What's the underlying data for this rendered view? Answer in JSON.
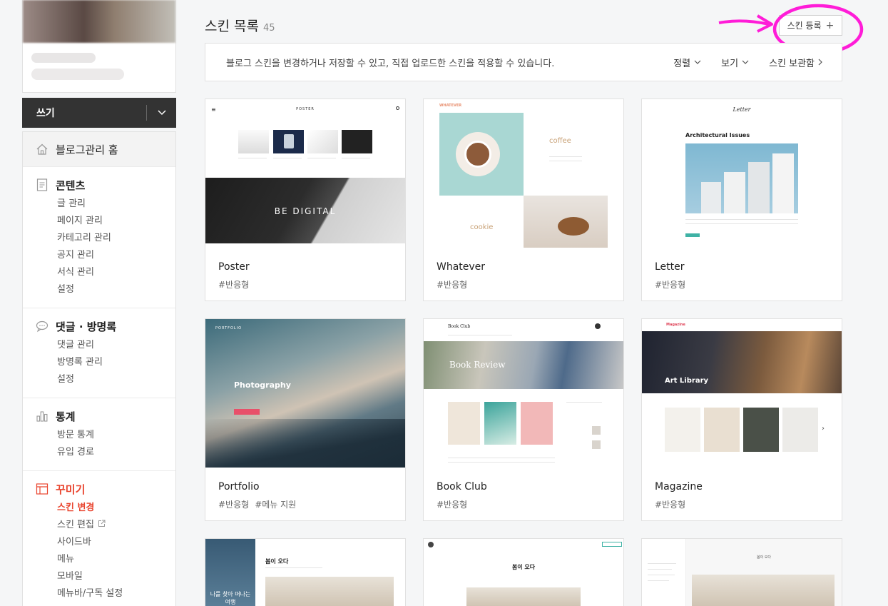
{
  "sidebar": {
    "write_label": "쓰기",
    "home_label": "블로그관리 홈",
    "sections": [
      {
        "title": "콘텐츠",
        "items": [
          "글 관리",
          "페이지 관리",
          "카테고리 관리",
          "공지 관리",
          "서식 관리",
          "설정"
        ]
      },
      {
        "title": "댓글 · 방명록",
        "items": [
          "댓글 관리",
          "방명록 관리",
          "설정"
        ]
      },
      {
        "title": "통계",
        "items": [
          "방문 통계",
          "유입 경로"
        ]
      },
      {
        "title": "꾸미기",
        "items": [
          "스킨 변경",
          "스킨 편집",
          "사이드바",
          "메뉴",
          "모바일",
          "메뉴바/구독 설정"
        ]
      }
    ]
  },
  "header": {
    "title": "스킨 목록",
    "count": "45",
    "register_label": "스킨 등록"
  },
  "info_bar": {
    "text": "블로그 스킨을 변경하거나 저장할 수 있고, 직접 업로드한 스킨을 적용할 수 있습니다.",
    "sort_label": "정렬",
    "view_label": "보기",
    "storage_label": "스킨 보관함"
  },
  "skins": [
    {
      "name": "Poster",
      "tags": [
        "#반응형"
      ],
      "thumb": {
        "brand": "POSTER",
        "banner": "BE DIGITAL"
      }
    },
    {
      "name": "Whatever",
      "tags": [
        "#반응형"
      ],
      "thumb": {
        "brand": "WHATEVER",
        "word1": "coffee",
        "word2": "cookie"
      }
    },
    {
      "name": "Letter",
      "tags": [
        "#반응형"
      ],
      "thumb": {
        "brand": "Letter",
        "heading": "Architectural Issues"
      }
    },
    {
      "name": "Portfolio",
      "tags": [
        "#반응형",
        "#메뉴 지원"
      ],
      "thumb": {
        "brand": "PORTFOLIO",
        "heading": "Photography"
      }
    },
    {
      "name": "Book Club",
      "tags": [
        "#반응형"
      ],
      "thumb": {
        "brand": "Book Club",
        "heading": "Book Review"
      }
    },
    {
      "name": "Magazine",
      "tags": [
        "#반응형"
      ],
      "thumb": {
        "brand": "Magazine",
        "heading": "Art Library"
      }
    },
    {
      "thumb": {
        "heading": "봄이 오다",
        "side": "나를 찾아 떠나는 여행"
      }
    },
    {
      "thumb": {
        "heading": "봄이 오다"
      }
    },
    {
      "thumb": {
        "heading": "봄이 오다"
      }
    }
  ],
  "colors": {
    "accent_red": "#e9452f",
    "write_bg": "#333333",
    "annotation_magenta": "#ff1cd8"
  }
}
